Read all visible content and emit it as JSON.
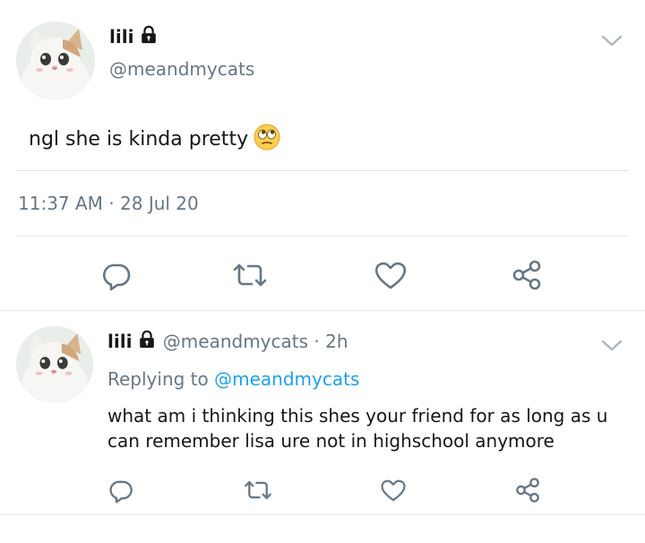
{
  "main_tweet": {
    "author_name": "lili",
    "handle": "@meandmycats",
    "text": "ngl she is kinda pretty",
    "emoji": "face-with-rolling-eyes",
    "time": "11:37 AM",
    "separator": "·",
    "date": "28 Jul 20"
  },
  "reply_tweet": {
    "author_name": "lili",
    "handle": "@meandmycats",
    "separator": "·",
    "age": "2h",
    "replying_prefix": "Replying to",
    "replying_to": "@meandmycats",
    "text": "what am i thinking this shes your friend for as long as u can remember lisa ure not in highschool anymore"
  },
  "icons": {
    "protected": "lock-icon",
    "menu": "chevron-down-icon",
    "reply": "reply-icon",
    "retweet": "retweet-icon",
    "like": "heart-icon",
    "share": "share-icon"
  },
  "colors": {
    "text": "#14171a",
    "secondary": "#657786",
    "link": "#1da1f2",
    "divider": "#e1e8ed",
    "icon": "#657786"
  }
}
